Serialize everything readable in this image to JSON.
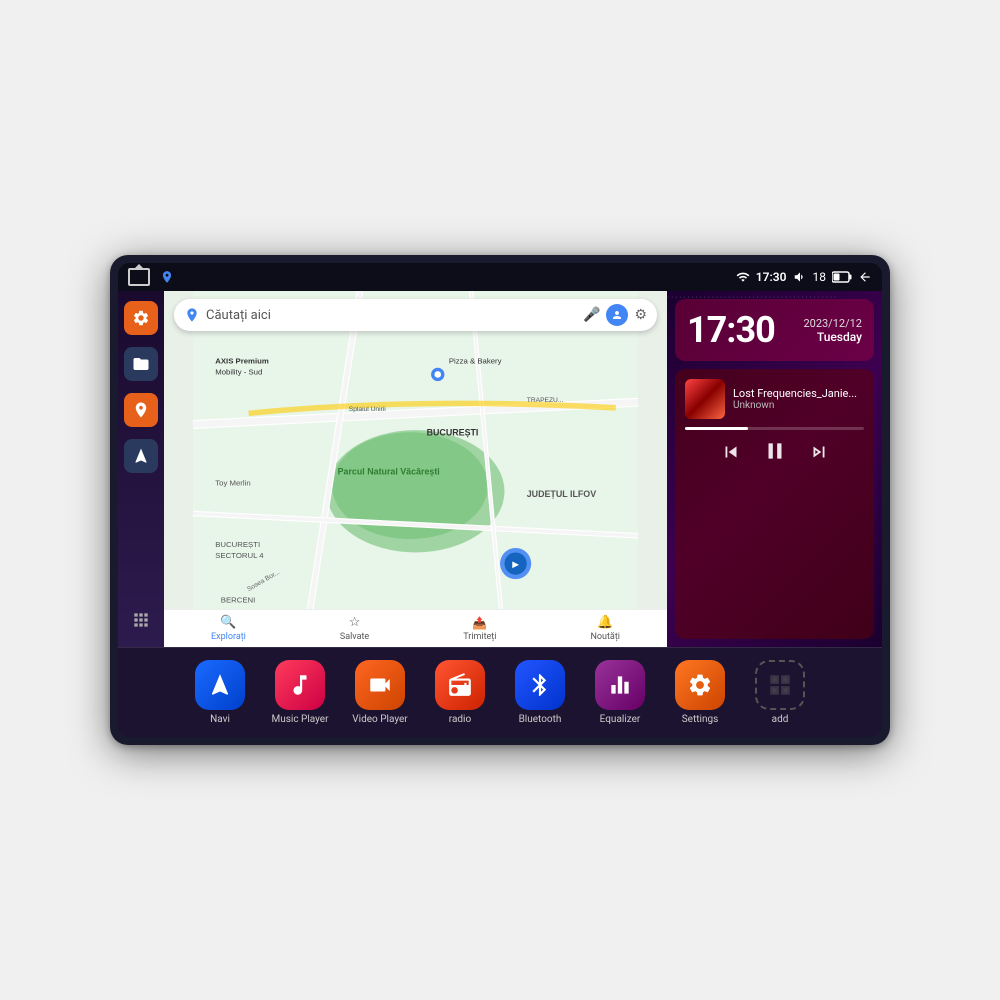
{
  "device": {
    "statusBar": {
      "leftIcons": [
        "home",
        "map"
      ],
      "time": "17:30",
      "rightIcons": [
        "wifi",
        "volume",
        "battery",
        "back"
      ],
      "batteryLevel": "18"
    },
    "clock": {
      "time": "17:30",
      "date": "2023/12/12",
      "day": "Tuesday"
    },
    "music": {
      "trackName": "Lost Frequencies_Janie...",
      "artist": "Unknown",
      "progressPercent": 35
    },
    "map": {
      "searchPlaceholder": "Căutați aici",
      "landmarks": [
        "AXIS Premium Mobility - Sud",
        "Pizza & Bakery",
        "Parcul Natural Văcărești",
        "BUCUREȘTI",
        "BUCUREȘTI SECTORUL 4",
        "BERCENI",
        "JUDEȚUL ILFOV",
        "Toy Merlin",
        "TRAPEZU..."
      ],
      "bottomTabs": [
        {
          "label": "Explorați",
          "icon": "🔍"
        },
        {
          "label": "Salvate",
          "icon": "☆"
        },
        {
          "label": "Trimiteți",
          "icon": "➤"
        },
        {
          "label": "Noutăți",
          "icon": "🔔"
        }
      ]
    },
    "sidebar": {
      "items": [
        {
          "icon": "⚙",
          "type": "settings"
        },
        {
          "icon": "📁",
          "type": "files"
        },
        {
          "icon": "📍",
          "type": "location"
        },
        {
          "icon": "➤",
          "type": "navigate"
        },
        {
          "icon": "⠿",
          "type": "apps"
        }
      ]
    },
    "dock": {
      "items": [
        {
          "id": "navi",
          "label": "Navi",
          "iconType": "navi",
          "icon": "➤"
        },
        {
          "id": "music-player",
          "label": "Music Player",
          "iconType": "music",
          "icon": "♪"
        },
        {
          "id": "video-player",
          "label": "Video Player",
          "iconType": "video",
          "icon": "▶"
        },
        {
          "id": "radio",
          "label": "radio",
          "iconType": "radio",
          "icon": "📻"
        },
        {
          "id": "bluetooth",
          "label": "Bluetooth",
          "iconType": "bluetooth",
          "icon": "⚡"
        },
        {
          "id": "equalizer",
          "label": "Equalizer",
          "iconType": "equalizer",
          "icon": "≡"
        },
        {
          "id": "settings",
          "label": "Settings",
          "iconType": "settings",
          "icon": "⚙"
        },
        {
          "id": "add",
          "label": "add",
          "iconType": "add",
          "icon": "+"
        }
      ]
    }
  }
}
